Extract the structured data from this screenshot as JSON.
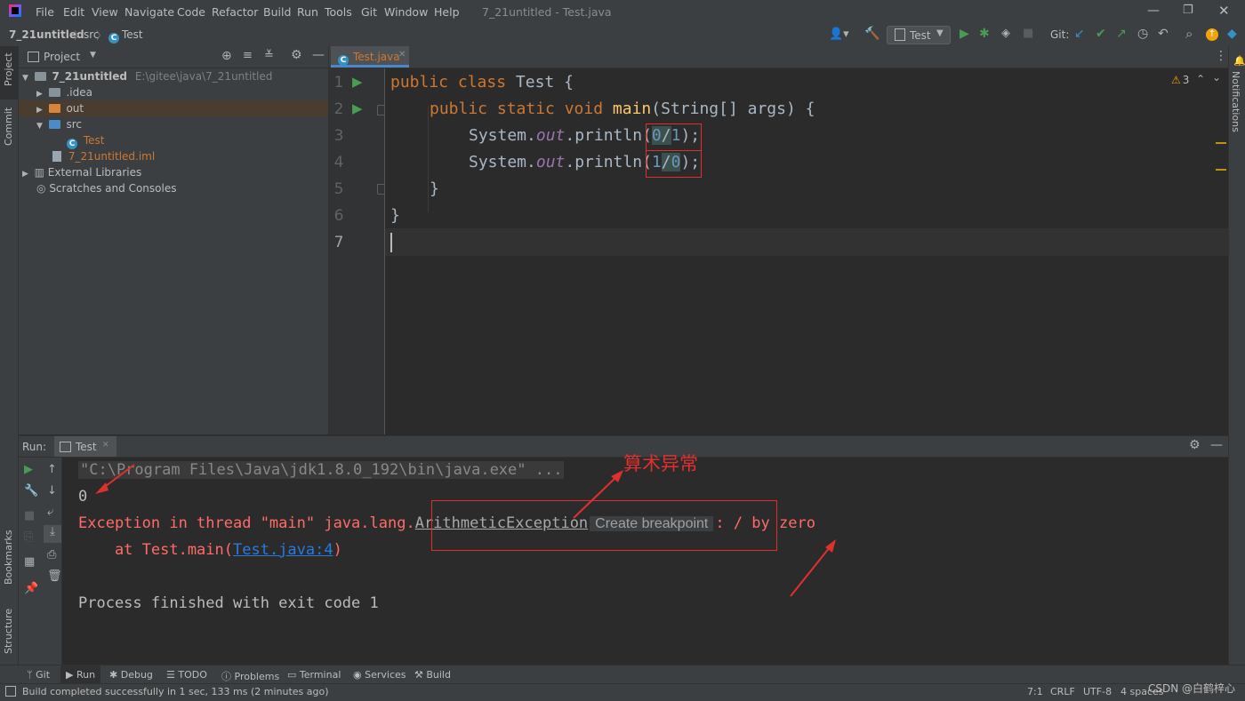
{
  "app": {
    "window_title": "7_21untitled - Test.java",
    "menu": [
      "File",
      "Edit",
      "View",
      "Navigate",
      "Code",
      "Refactor",
      "Build",
      "Run",
      "Tools",
      "Git",
      "Window",
      "Help"
    ]
  },
  "navbar": {
    "breadcrumbs": [
      "7_21untitled",
      "src",
      "Test"
    ],
    "run_config": "Test",
    "git_label": "Git:"
  },
  "left_stripe": {
    "project": "Project",
    "commit": "Commit",
    "bookmarks": "Bookmarks",
    "structure": "Structure"
  },
  "right_stripe": {
    "notifications": "Notifications"
  },
  "project_panel": {
    "title": "Project",
    "root_name": "7_21untitled",
    "root_path": "E:\\gitee\\java\\7_21untitled",
    "items": [
      ".idea",
      "out",
      "src",
      "Test",
      "7_21untitled.iml",
      "External Libraries",
      "Scratches and Consoles"
    ]
  },
  "editor": {
    "tab": "Test.java",
    "warnings": "3",
    "line_numbers": [
      "1",
      "2",
      "3",
      "4",
      "5",
      "6",
      "7"
    ],
    "code": {
      "l1_kw": "public class ",
      "l1_name": "Test {",
      "l2_kw": "public static void ",
      "l2_fn": "main",
      "l2_rest": "(String[] args) {",
      "l3_a": "System.",
      "l3_b": "out",
      "l3_c": ".println(",
      "l3_d": "0",
      "l3_e": "/",
      "l3_f": "1",
      "l3_g": ");",
      "l4_a": "System.",
      "l4_b": "out",
      "l4_c": ".println(",
      "l4_d": "1",
      "l4_e": "/",
      "l4_f": "0",
      "l4_g": ");",
      "l5": "}",
      "l6": "}"
    }
  },
  "run_panel": {
    "label": "Run:",
    "tab": "Test",
    "console": {
      "cmd": "\"C:\\Program Files\\Java\\jdk1.8.0_192\\bin\\java.exe\" ...",
      "out_0": "0",
      "exc_prefix": "Exception in thread \"main\" java.lang.",
      "exc_class": "ArithmeticException",
      "create_breakpoint": "Create breakpoint",
      "exc_suffix": ": / by zero",
      "at_prefix": "    at Test.main(",
      "at_link": "Test.java:4",
      "at_suffix": ")",
      "finished": "Process finished with exit code 1"
    },
    "annotation": "算术异常"
  },
  "tool_windows": [
    "Git",
    "Run",
    "Debug",
    "TODO",
    "Problems",
    "Terminal",
    "Services",
    "Build"
  ],
  "status_bar": {
    "message": "Build completed successfully in 1 sec, 133 ms (2 minutes ago)",
    "position": "7:1",
    "line_sep": "CRLF",
    "encoding": "UTF-8",
    "indent": "4 spaces",
    "watermark": "CSDN @白鹤梓心"
  },
  "colors": {
    "accent_red": "#e0302e",
    "keyword": "#cc7832",
    "function": "#ffc66d",
    "error_text": "#ff6b68",
    "link": "#287bde"
  }
}
